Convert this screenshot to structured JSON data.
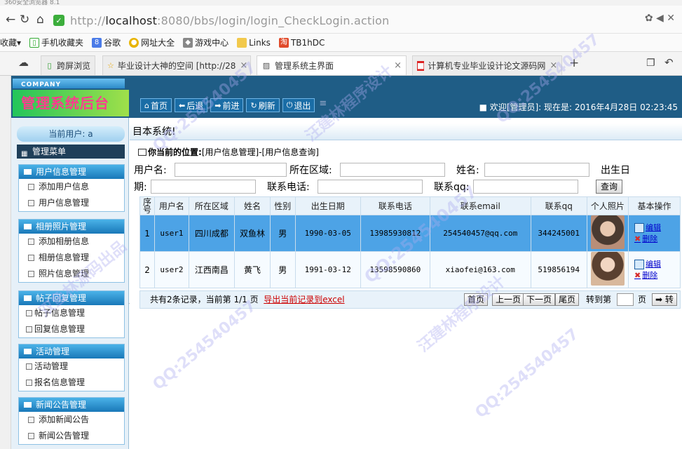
{
  "browser": {
    "title_fragment": "360安全浏览器 8.1",
    "url_prefix": "http://",
    "url_host": "localhost",
    "url_rest": ":8080/bbs/login/login_CheckLogin.action",
    "bookmarks": [
      "收藏",
      "手机收藏夹",
      "谷歌",
      "网址大全",
      "游戏中心",
      "Links",
      "TB1hDC"
    ],
    "tabs": [
      {
        "label": "跨屏浏览"
      },
      {
        "label": "毕业设计大神的空间 [http://28"
      },
      {
        "label": "管理系统主界面"
      },
      {
        "label": "计算机专业毕业设计论文源码网"
      }
    ]
  },
  "header": {
    "company": "COMPANY",
    "title": "管理系统后台",
    "toolbar": [
      "首页",
      "后退",
      "前进",
      "刷新",
      "退出"
    ],
    "welcome": "■ 欢迎[管理员]: 现在是: 2016年4月28日 02:23:45"
  },
  "sidebar": {
    "current_user": "当前用户: a",
    "menu_title": "管理菜单",
    "groups": [
      {
        "title": "用户信息管理",
        "items": [
          "添加用户信息",
          "用户信息管理"
        ]
      },
      {
        "title": "相册照片管理",
        "items": [
          "添加相册信息",
          "相册信息管理",
          "照片信息管理"
        ]
      },
      {
        "title": "帖子回复管理",
        "items": [
          "帖子信息管理",
          "回复信息管理"
        ]
      },
      {
        "title": "活动管理",
        "items": [
          "活动管理",
          "报名信息管理"
        ]
      },
      {
        "title": "新闻公告管理",
        "items": [
          "添加新闻公告",
          "新闻公告管理"
        ]
      }
    ]
  },
  "main": {
    "marquee": "目本系统!",
    "location_label": "你当前的位置:",
    "location_path": "[用户信息管理]-[用户信息查询]",
    "form": {
      "username_label": "用户名:",
      "area_label": "所在区域:",
      "name_label": "姓名:",
      "birth_label_1": "出生日",
      "birth_label_2": "期:",
      "phone_label": "联系电话:",
      "qq_label": "联系qq:",
      "query_button": "查询"
    },
    "table": {
      "headers": [
        "序号",
        "用户名",
        "所在区域",
        "姓名",
        "性别",
        "出生日期",
        "联系电话",
        "联系email",
        "联系qq",
        "个人照片",
        "基本操作"
      ],
      "rows": [
        {
          "no": "1",
          "username": "user1",
          "area": "四川成都",
          "name": "双鱼林",
          "gender": "男",
          "birth": "1990-03-05",
          "phone": "13985930812",
          "email": "254540457@qq.com",
          "qq": "344245001",
          "edit": "编辑",
          "delete": "删除"
        },
        {
          "no": "2",
          "username": "user2",
          "area": "江西南昌",
          "name": "黄飞",
          "gender": "男",
          "birth": "1991-03-12",
          "phone": "13598590860",
          "email": "xiaofei@163.com",
          "qq": "519856194",
          "edit": "编辑",
          "delete": "删除"
        }
      ]
    },
    "pager": {
      "summary": "共有2条记录，当前第 1/1 页",
      "export": "导出当前记录到excel",
      "first": "首页",
      "prev": "上一页",
      "next": "下一页",
      "last": "尾页",
      "goto_label": "转到第",
      "page_unit": "页",
      "go": "➡ 转"
    }
  },
  "watermark": {
    "qq": "QQ:254540457",
    "source": "双鱼林源码出品",
    "author": "汪建林程序设计"
  }
}
